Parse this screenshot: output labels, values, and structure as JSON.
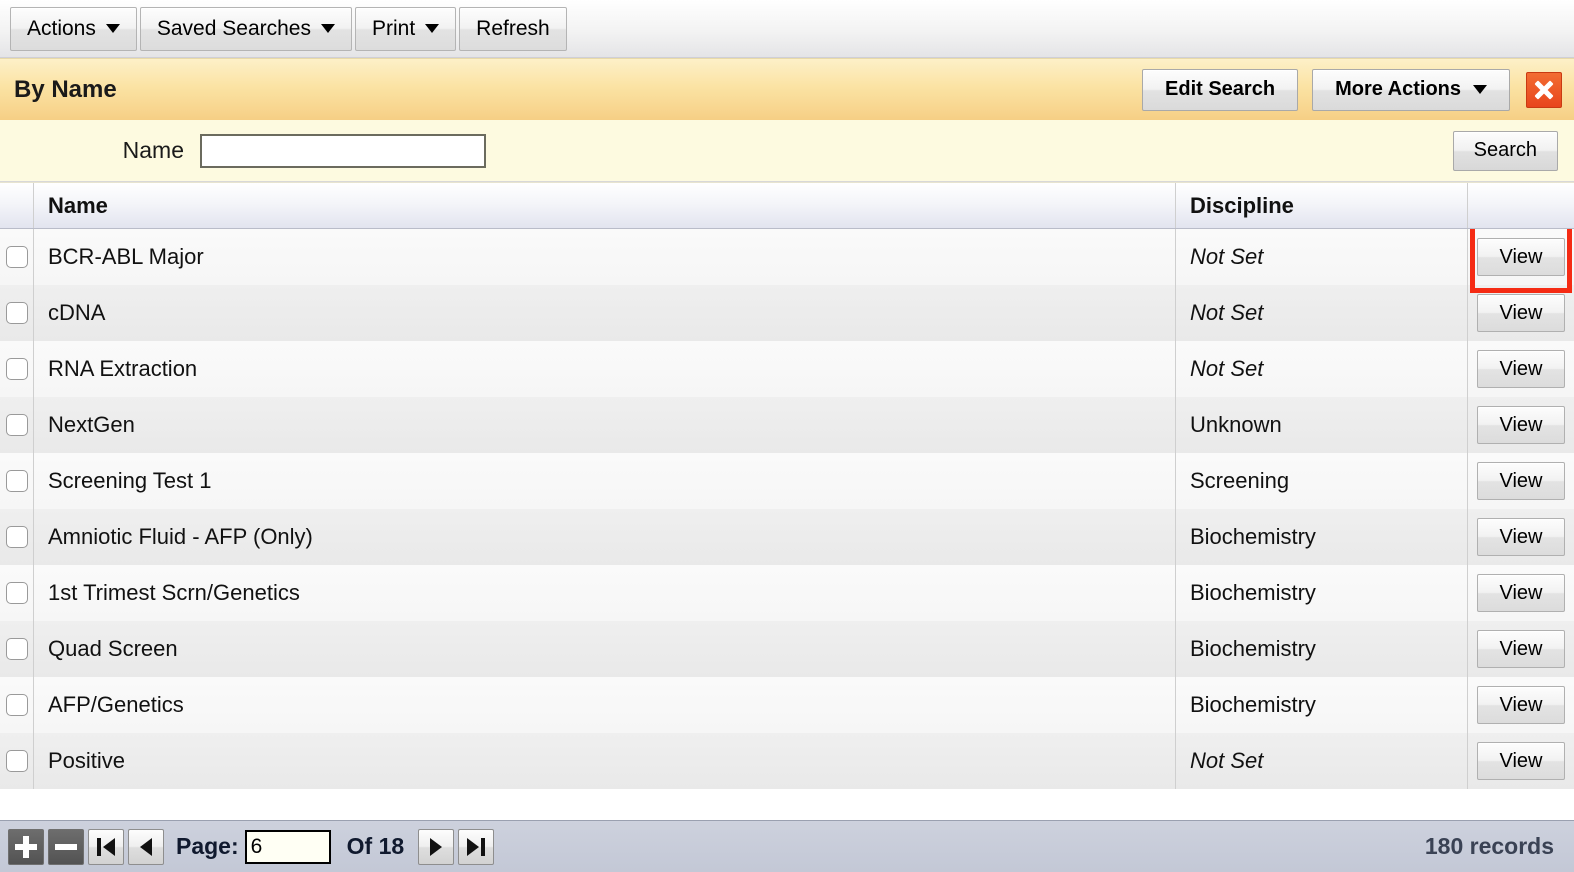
{
  "toolbar": {
    "buttons": [
      {
        "label": "Actions",
        "has_caret": true
      },
      {
        "label": "Saved Searches",
        "has_caret": true
      },
      {
        "label": "Print",
        "has_caret": true
      },
      {
        "label": "Refresh",
        "has_caret": false
      }
    ]
  },
  "search_header": {
    "title": "By Name",
    "edit_search_label": "Edit Search",
    "more_actions_label": "More Actions",
    "close_icon": "close-x-icon",
    "accent_color": "#f6cf85",
    "close_color": "#e8451c"
  },
  "search_panel": {
    "field_label": "Name",
    "field_value": "",
    "field_placeholder": "",
    "search_button_label": "Search"
  },
  "grid": {
    "columns": [
      {
        "key": "check",
        "label": ""
      },
      {
        "key": "name",
        "label": "Name"
      },
      {
        "key": "discipline",
        "label": "Discipline"
      },
      {
        "key": "action",
        "label": ""
      }
    ],
    "action_label": "View",
    "highlight_color": "#f52b14",
    "rows": [
      {
        "name": "BCR-ABL Major",
        "discipline": "Not Set",
        "discipline_italic": true,
        "checked": false,
        "highlighted": true
      },
      {
        "name": "cDNA",
        "discipline": "Not Set",
        "discipline_italic": true,
        "checked": false,
        "highlighted": false
      },
      {
        "name": "RNA Extraction",
        "discipline": "Not Set",
        "discipline_italic": true,
        "checked": false,
        "highlighted": false
      },
      {
        "name": "NextGen",
        "discipline": "Unknown",
        "discipline_italic": false,
        "checked": false,
        "highlighted": false
      },
      {
        "name": "Screening Test 1",
        "discipline": "Screening",
        "discipline_italic": false,
        "checked": false,
        "highlighted": false
      },
      {
        "name": "Amniotic Fluid - AFP (Only)",
        "discipline": "Biochemistry",
        "discipline_italic": false,
        "checked": false,
        "highlighted": false
      },
      {
        "name": "1st Trimest Scrn/Genetics",
        "discipline": "Biochemistry",
        "discipline_italic": false,
        "checked": false,
        "highlighted": false
      },
      {
        "name": "Quad Screen",
        "discipline": "Biochemistry",
        "discipline_italic": false,
        "checked": false,
        "highlighted": false
      },
      {
        "name": "AFP/Genetics",
        "discipline": "Biochemistry",
        "discipline_italic": false,
        "checked": false,
        "highlighted": false
      },
      {
        "name": "Positive",
        "discipline": "Not Set",
        "discipline_italic": true,
        "checked": false,
        "highlighted": false
      }
    ]
  },
  "footer": {
    "add_icon": "plus-icon",
    "remove_icon": "minus-icon",
    "first_page_icon": "first-page-icon",
    "prev_page_icon": "prev-page-icon",
    "next_page_icon": "next-page-icon",
    "last_page_icon": "last-page-icon",
    "page_label": "Page:",
    "page_value": "6",
    "of_label": "Of 18",
    "total_pages": "18",
    "records_label": "180 records"
  }
}
